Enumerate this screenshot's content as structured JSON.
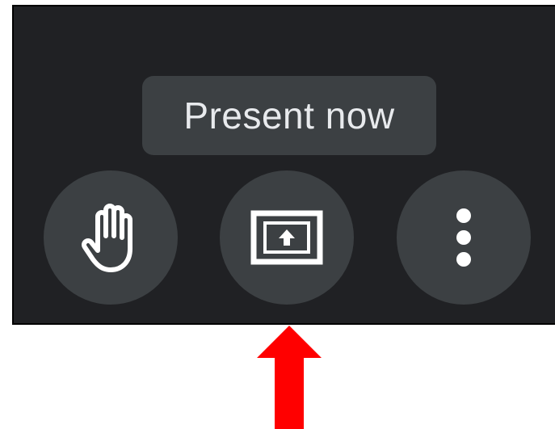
{
  "tooltip": {
    "text": "Present now"
  },
  "controls": [
    {
      "name": "raise-hand-button",
      "icon": "hand-icon"
    },
    {
      "name": "present-now-button",
      "icon": "present-screen-icon"
    },
    {
      "name": "more-options-button",
      "icon": "more-vert-icon"
    }
  ],
  "colors": {
    "panel_background": "#202124",
    "button_background": "#3c4043",
    "tooltip_background": "#3c4043",
    "icon_color": "#ffffff",
    "tooltip_text": "#e8eaed",
    "annotation_arrow": "#ff0000"
  }
}
